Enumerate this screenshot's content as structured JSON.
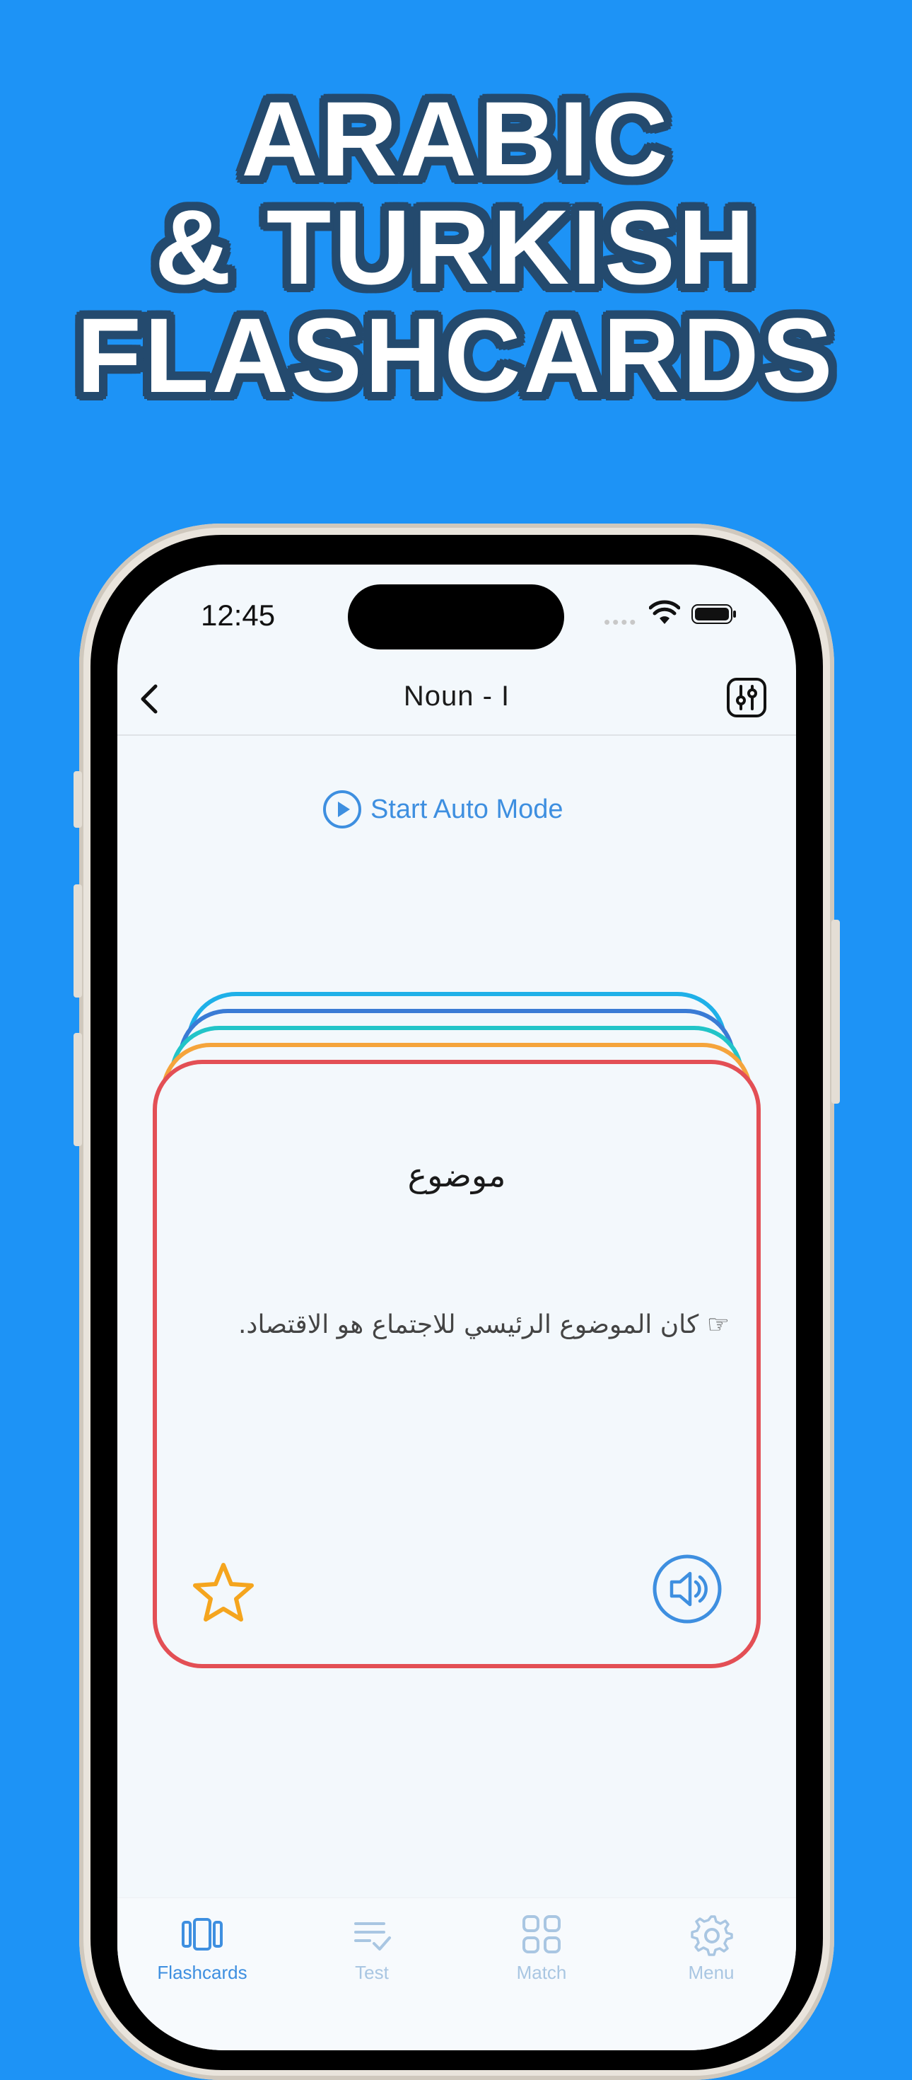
{
  "headline": {
    "line1": "ARABIC",
    "line2": "& TURKISH",
    "line3": "FLASHCARDS"
  },
  "status_bar": {
    "time": "12:45"
  },
  "nav": {
    "title": "Noun - I",
    "back_icon": "chevron-left-icon",
    "settings_icon": "sliders-icon"
  },
  "auto_mode": {
    "label": "Start Auto Mode"
  },
  "card": {
    "word": "موضوع",
    "example": "☞  كان الموضوع الرئيسي للاجتماع هو الاقتصاد.",
    "star_icon": "star-icon",
    "sound_icon": "speaker-icon"
  },
  "stack_colors": [
    "#1fb0e8",
    "#3a7bd5",
    "#22c4c8",
    "#f5a43c",
    "#e34f55"
  ],
  "tabs": [
    {
      "label": "Flashcards",
      "icon": "cards-icon",
      "active": true
    },
    {
      "label": "Test",
      "icon": "checklist-icon",
      "active": false
    },
    {
      "label": "Match",
      "icon": "grid-icon",
      "active": false
    },
    {
      "label": "Menu",
      "icon": "gear-icon",
      "active": false
    }
  ],
  "colors": {
    "background": "#1d93f6",
    "headline_outline": "#244a6e",
    "accent": "#3e8fe0",
    "card_border": "#e34f55",
    "star": "#f5a51e"
  }
}
